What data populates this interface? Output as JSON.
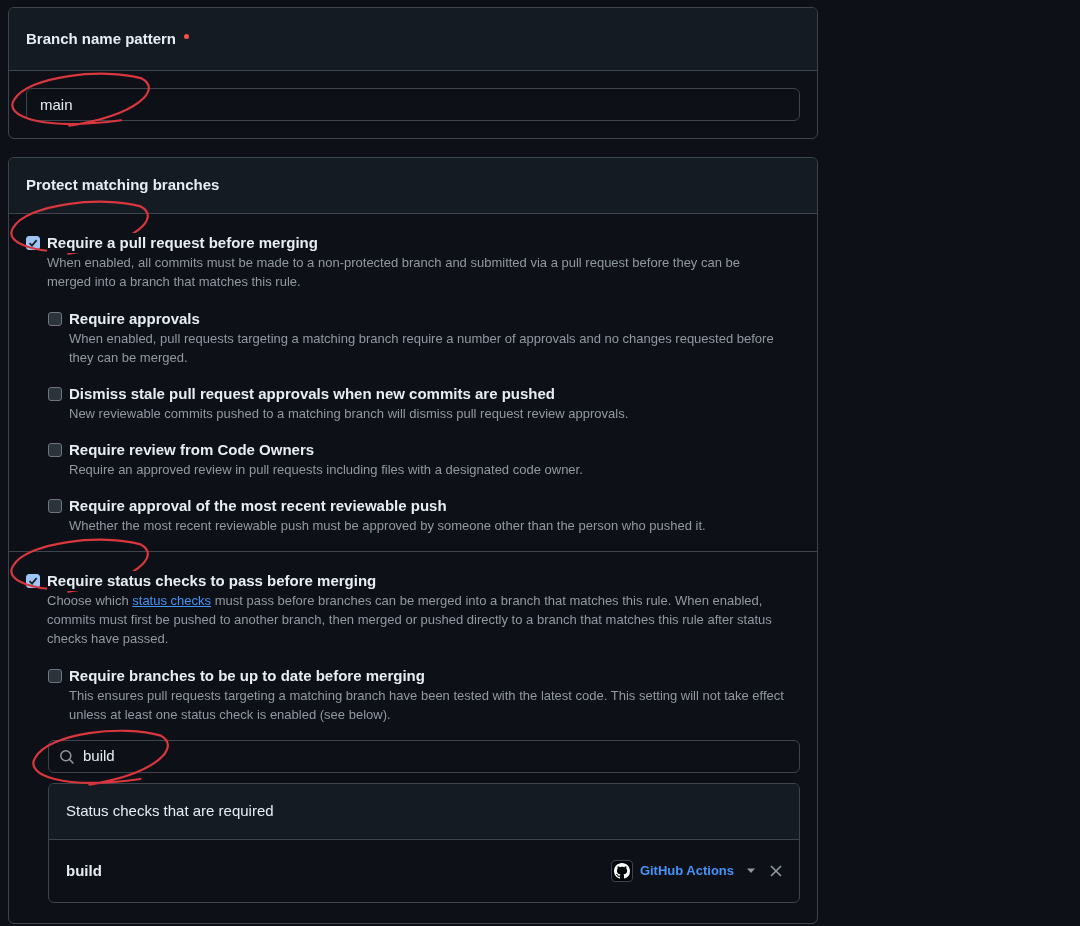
{
  "branch_name_pattern": {
    "label": "Branch name pattern",
    "required": true,
    "value": "main",
    "highlighted": true
  },
  "protect_section": {
    "title": "Protect matching branches"
  },
  "rules": [
    {
      "title": "Require a pull request before merging",
      "checked": true,
      "highlighted": true,
      "description": [
        {
          "text": "When enabled, all commits must be made to a non-protected branch and submitted via a pull request before they can be merged into a branch that matches this rule."
        }
      ],
      "children": [
        {
          "title": "Require approvals",
          "checked": false,
          "description": [
            {
              "text": "When enabled, pull requests targeting a matching branch require a number of approvals and no changes requested before they can be merged."
            }
          ]
        },
        {
          "title": "Dismiss stale pull request approvals when new commits are pushed",
          "checked": false,
          "description": [
            {
              "text": "New reviewable commits pushed to a matching branch will dismiss pull request review approvals."
            }
          ]
        },
        {
          "title": "Require review from Code Owners",
          "checked": false,
          "description": [
            {
              "text": "Require an approved review in pull requests including files with a designated code owner."
            }
          ]
        },
        {
          "title": "Require approval of the most recent reviewable push",
          "checked": false,
          "description": [
            {
              "text": "Whether the most recent reviewable push must be approved by someone other than the person who pushed it."
            }
          ]
        }
      ]
    },
    {
      "title": "Require status checks to pass before merging",
      "checked": true,
      "highlighted": true,
      "description": [
        {
          "text": "Choose which "
        },
        {
          "text": "status checks",
          "kind": "link"
        },
        {
          "text": " must pass before branches can be merged into a branch that matches this rule. When enabled, commits must first be pushed to another branch, then merged or pushed directly to a branch that matches this rule after status checks have passed."
        }
      ],
      "children": [
        {
          "title": "Require branches to be up to date before merging",
          "checked": false,
          "description": [
            {
              "text": "This ensures pull requests targeting a matching branch have been tested with the latest code. This setting will not take effect unless at least one status check is enabled (see below)."
            }
          ]
        }
      ],
      "search": {
        "value": "build",
        "highlighted": true
      },
      "required_checks": {
        "title": "Status checks that are required",
        "items": [
          {
            "name": "build",
            "app": "GitHub Actions"
          }
        ]
      }
    }
  ]
}
